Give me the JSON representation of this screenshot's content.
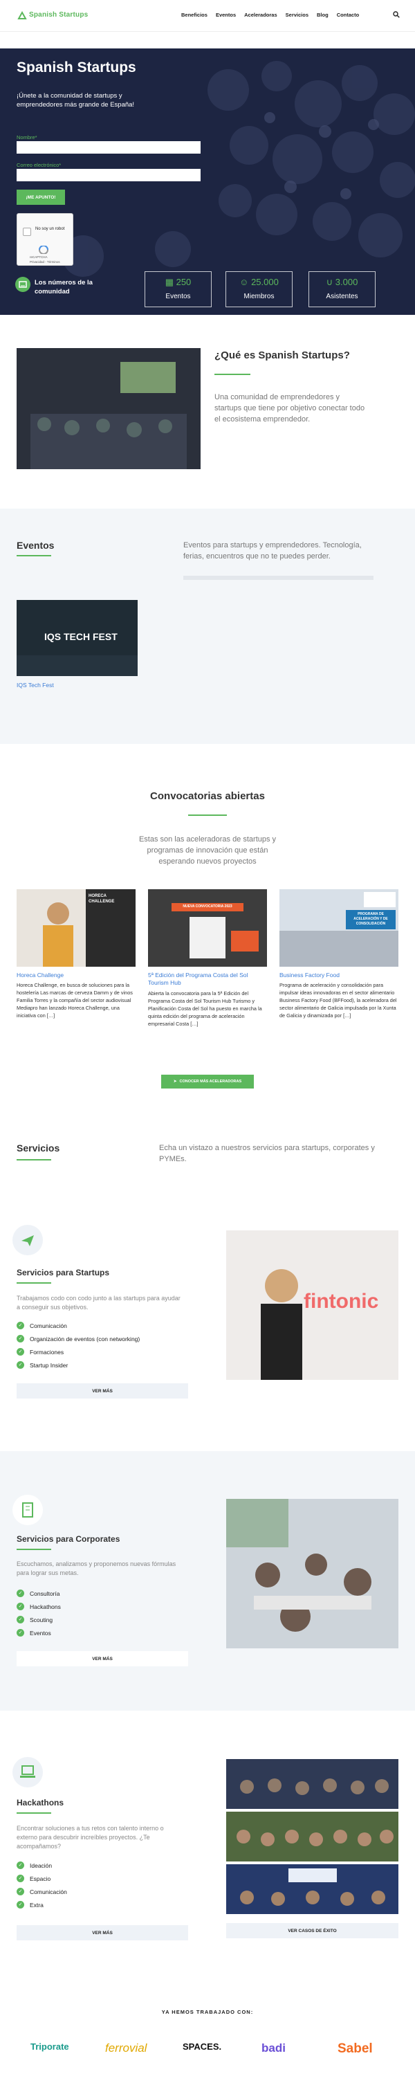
{
  "header": {
    "brand": "Spanish Startups",
    "nav": [
      "Beneficios",
      "Eventos",
      "Aceleradoras",
      "Servicios",
      "Blog",
      "Contacto"
    ]
  },
  "hero": {
    "title": "Spanish Startups",
    "subtitle": "¡Únete a la comunidad de startups y emprendedores más grande de España!",
    "name_label": "Nombre*",
    "email_label": "Correo electrónico*",
    "submit_label": "¡ME APUNTO!",
    "captcha_text": "No soy un robot",
    "captcha_brand": "reCAPTCHA",
    "captcha_links": "Privacidad - Términos",
    "stats_title": "Los números de la comunidad",
    "stats": [
      {
        "icon": "calendar-icon",
        "number": "250",
        "label": "Eventos"
      },
      {
        "icon": "people-icon",
        "number": "25.000",
        "label": "Miembros"
      },
      {
        "icon": "magnet-icon",
        "number": "3.000",
        "label": "Asistentes"
      }
    ]
  },
  "about": {
    "title": "¿Qué es Spanish Startups?",
    "description": "Una comunidad de emprendedores y startups que tiene por objetivo conectar todo el ecosistema emprendedor."
  },
  "events": {
    "title": "Eventos",
    "description": "Eventos para startups y emprendedores. Tecnología, ferias, encuentros que no te puedes perder.",
    "items": [
      {
        "image_text": "IQS TECH FEST",
        "title": "IQS Tech Fest"
      }
    ]
  },
  "calls": {
    "title": "Convocatorias abiertas",
    "description": "Estas son las aceleradoras de startups y programas de innovación que están esperando nuevos proyectos",
    "items": [
      {
        "image_text": "HORECA CHALLENGE",
        "title": "Horeca Challenge",
        "text": "Horeca Challenge, en busca de soluciones para la hostelería Las marcas de cerveza Damm y de vinos Familia Torres y la compañía del sector audiovisual Mediapro han lanzado Horeca Challenge, una iniciativa con […]"
      },
      {
        "image_text": "NUEVA CONVOCATORIA 2023",
        "title": "5ª Edición del Programa Costa del Sol Tourism Hub",
        "text": "Abierta la convocatoria para la 5ª Edición del Programa Costa del Sol Tourism Hub Turismo y Planificación Costa del Sol ha puesto en marcha la quinta edición del programa de aceleración empresarial Costa […]"
      },
      {
        "image_text": "PROGRAMA DE ACELERACIÓN Y DE CONSOLIDACIÓN",
        "title": "Business Factory Food",
        "text": "Programa de aceleración y consolidación para impulsar ideas innovadoras en el sector alimentario Business Factory Food (BFFood), la aceleradora del sector alimentario de Galicia impulsada por la Xunta de Galicia y dinamizada por […]"
      }
    ],
    "button": "CONOCER MÁS ACELERADORAS"
  },
  "services": {
    "title": "Servicios",
    "description": "Echa un vistazo a nuestros servicios para startups, corporates y PYMEs.",
    "blocks": [
      {
        "icon": "paper-plane-icon",
        "title": "Servicios para Startups",
        "description": "Trabajamos codo con codo junto a las startups para ayudar a conseguir sus objetivos.",
        "items": [
          "Comunicación",
          "Organización de eventos (con networking)",
          "Formaciones",
          "Startup Insider"
        ],
        "button": "VER MÁS",
        "image_text": "fintonic"
      },
      {
        "icon": "building-icon",
        "title": "Servicios para Corporates",
        "description": "Escuchamos, analizamos y proponemos nuevas fórmulas para lograr sus metas.",
        "items": [
          "Consultoría",
          "Hackathons",
          "Scouting",
          "Eventos"
        ],
        "button": "VER MÁS"
      },
      {
        "icon": "laptop-icon",
        "title": "Hackathons",
        "description": "Encontrar soluciones a tus retos con talento interno o externo para descubrir increíbles proyectos. ¿Te acompañamos?",
        "items": [
          "Ideación",
          "Espacio",
          "Comunicación",
          "Extra"
        ],
        "button": "VER MÁS",
        "button2": "VER CASOS DE ÉXITO"
      }
    ]
  },
  "partners": {
    "title": "YA HEMOS TRABAJADO CON:",
    "logos": [
      "Triporate",
      "ferrovial",
      "SPACES.",
      "badi",
      "Sabel"
    ]
  },
  "colors": {
    "accent": "#5cb85c",
    "hero_bg": "#1c2340",
    "link": "#3a7bd5",
    "light_bg": "#f3f6f9"
  }
}
